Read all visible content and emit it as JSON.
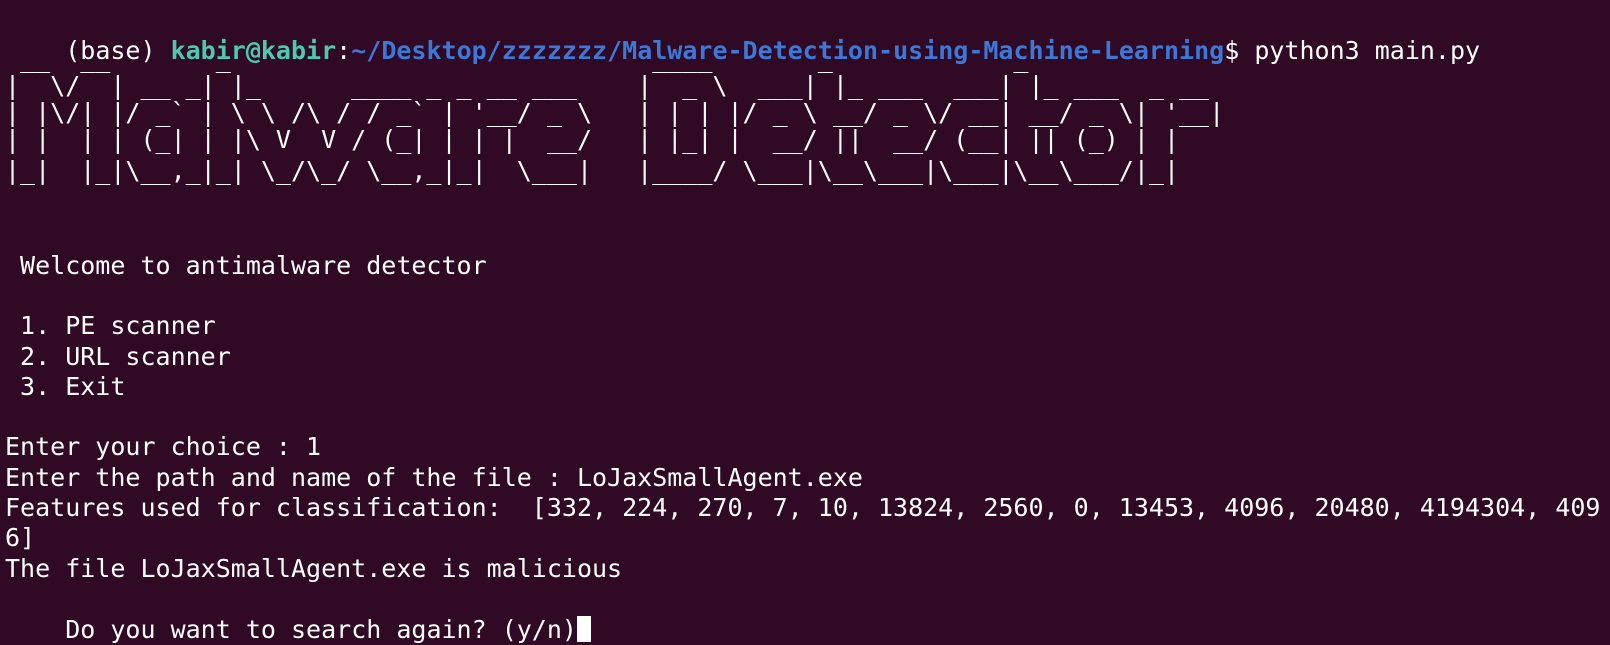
{
  "prompt": {
    "env": "(base) ",
    "user_host": "kabir@kabir",
    "colon": ":",
    "path": "~/Desktop/zzzzzzz/Malware-Detection-using-Machine-Learning",
    "symbol": "$ ",
    "command": "python3 main.py"
  },
  "banner": [
    " __  __       _                            ____       _            _",
    "|  \\/  | __ _| |_      ____ _ _ __ ___    |  _ \\  ___| |_ ___  ___| |_ ___  _ __",
    "| |\\/| |/ _` | \\ \\ /\\ / / _` | '__/ _ \\   | | | |/ _ \\ __/ _ \\/ __| __/ _ \\| '__|",
    "| |  | | (_| | |\\ V  V / (_| | | |  __/   | |_| |  __/ ||  __/ (__| || (_) | |",
    "|_|  |_|\\__,_|_| \\_/\\_/ \\__,_|_|  \\___|   |____/ \\___|\\__\\___|\\___|\\__\\___/|_|"
  ],
  "menu": {
    "welcome": " Welcome to antimalware detector",
    "option1": " 1. PE scanner",
    "option2": " 2. URL scanner",
    "option3": " 3. Exit"
  },
  "session": {
    "choice": "Enter your choice : 1",
    "path_prompt": "Enter the path and name of the file : LoJaxSmallAgent.exe",
    "features_line1": "Features used for classification:  [332, 224, 270, 7, 10, 13824, 2560, 0, 13453, 4096, 20480, 4194304, 409",
    "features_line2": "6]",
    "result": "The file LoJaxSmallAgent.exe is malicious",
    "again_prompt": "Do you want to search again? (y/n)"
  },
  "colors": {
    "background": "#300a24",
    "text": "#ffffff",
    "user_host": "#4ec9b0",
    "path": "#3c78d8"
  }
}
